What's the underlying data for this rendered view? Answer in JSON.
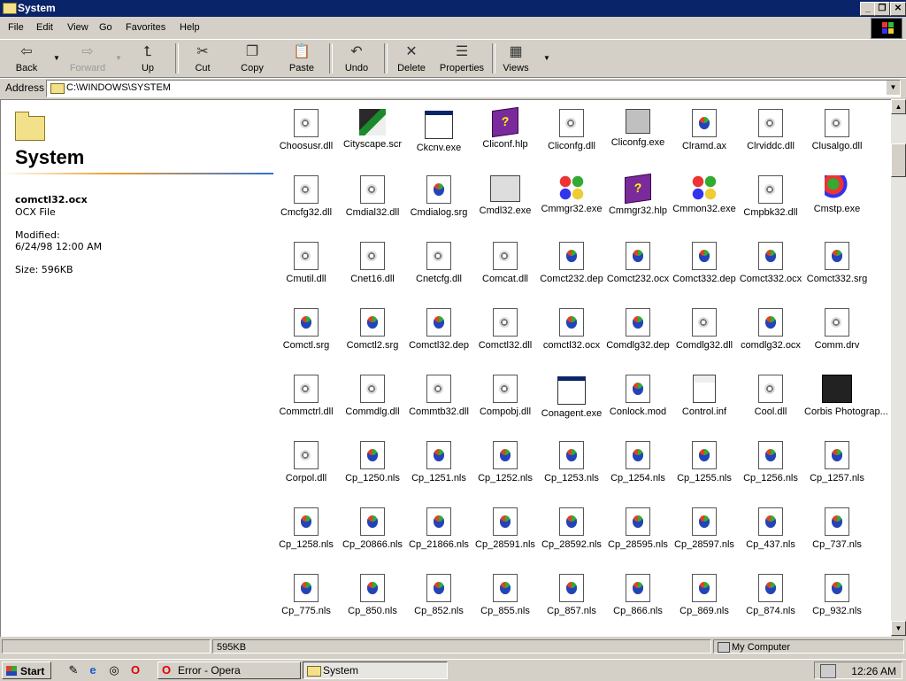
{
  "window": {
    "title": "System",
    "controls": [
      "_",
      "❐",
      "✕"
    ]
  },
  "menu": [
    "File",
    "Edit",
    "View",
    "Go",
    "Favorites",
    "Help"
  ],
  "toolbar": {
    "back": "Back",
    "forward": "Forward",
    "up": "Up",
    "cut": "Cut",
    "copy": "Copy",
    "paste": "Paste",
    "undo": "Undo",
    "delete": "Delete",
    "properties": "Properties",
    "views": "Views"
  },
  "address": {
    "label": "Address",
    "value": "C:\\WINDOWS\\SYSTEM"
  },
  "sidebar": {
    "title": "System",
    "file_name": "comctl32.ocx",
    "file_type": "OCX File",
    "modified_label": "Modified:",
    "modified_value": "6/24/98 12:00 AM",
    "size": "Size: 596KB"
  },
  "files": [
    {
      "name": "Choosusr.dll",
      "icon": "gear-doc"
    },
    {
      "name": "Cityscape.scr",
      "icon": "screensaver"
    },
    {
      "name": "Ckcnv.exe",
      "icon": "app-window"
    },
    {
      "name": "Cliconf.hlp",
      "icon": "help-book"
    },
    {
      "name": "Cliconfg.dll",
      "icon": "gear-doc"
    },
    {
      "name": "Cliconfg.exe",
      "icon": "computer"
    },
    {
      "name": "Clramd.ax",
      "icon": "windows-doc"
    },
    {
      "name": "Clrviddc.dll",
      "icon": "gear-doc"
    },
    {
      "name": "Clusalgo.dll",
      "icon": "gear-doc"
    },
    {
      "name": "Cmcfg32.dll",
      "icon": "gear-doc"
    },
    {
      "name": "Cmdial32.dll",
      "icon": "gear-doc"
    },
    {
      "name": "Cmdialog.srg",
      "icon": "windows-doc"
    },
    {
      "name": "Cmdl32.exe",
      "icon": "printer"
    },
    {
      "name": "Cmmgr32.exe",
      "icon": "command-knot"
    },
    {
      "name": "Cmmgr32.hlp",
      "icon": "help-book"
    },
    {
      "name": "Cmmon32.exe",
      "icon": "command-knot"
    },
    {
      "name": "Cmpbk32.dll",
      "icon": "gear-doc"
    },
    {
      "name": "Cmstp.exe",
      "icon": "cmstp"
    },
    {
      "name": "Cmutil.dll",
      "icon": "gear-doc"
    },
    {
      "name": "Cnet16.dll",
      "icon": "gear-doc"
    },
    {
      "name": "Cnetcfg.dll",
      "icon": "gear-doc"
    },
    {
      "name": "Comcat.dll",
      "icon": "gear-doc"
    },
    {
      "name": "Comct232.dep",
      "icon": "windows-doc"
    },
    {
      "name": "Comct232.ocx",
      "icon": "windows-doc"
    },
    {
      "name": "Comct332.dep",
      "icon": "windows-doc"
    },
    {
      "name": "Comct332.ocx",
      "icon": "windows-doc"
    },
    {
      "name": "Comct332.srg",
      "icon": "windows-doc"
    },
    {
      "name": "Comctl.srg",
      "icon": "windows-doc"
    },
    {
      "name": "Comctl2.srg",
      "icon": "windows-doc"
    },
    {
      "name": "Comctl32.dep",
      "icon": "windows-doc"
    },
    {
      "name": "Comctl32.dll",
      "icon": "gear-doc"
    },
    {
      "name": "comctl32.ocx",
      "icon": "windows-doc"
    },
    {
      "name": "Comdlg32.dep",
      "icon": "windows-doc"
    },
    {
      "name": "Comdlg32.dll",
      "icon": "gear-doc"
    },
    {
      "name": "comdlg32.ocx",
      "icon": "windows-doc"
    },
    {
      "name": "Comm.drv",
      "icon": "gear-doc"
    },
    {
      "name": "Commctrl.dll",
      "icon": "gear-doc"
    },
    {
      "name": "Commdlg.dll",
      "icon": "gear-doc"
    },
    {
      "name": "Commtb32.dll",
      "icon": "gear-doc"
    },
    {
      "name": "Compobj.dll",
      "icon": "gear-doc"
    },
    {
      "name": "Conagent.exe",
      "icon": "app-window"
    },
    {
      "name": "Conlock.mod",
      "icon": "windows-doc"
    },
    {
      "name": "Control.inf",
      "icon": "settings-sheet"
    },
    {
      "name": "Cool.dll",
      "icon": "gear-doc"
    },
    {
      "name": "Corbis Photograp...",
      "icon": "film-viewer"
    },
    {
      "name": "Corpol.dll",
      "icon": "gear-doc"
    },
    {
      "name": "Cp_1250.nls",
      "icon": "windows-doc"
    },
    {
      "name": "Cp_1251.nls",
      "icon": "windows-doc"
    },
    {
      "name": "Cp_1252.nls",
      "icon": "windows-doc"
    },
    {
      "name": "Cp_1253.nls",
      "icon": "windows-doc"
    },
    {
      "name": "Cp_1254.nls",
      "icon": "windows-doc"
    },
    {
      "name": "Cp_1255.nls",
      "icon": "windows-doc"
    },
    {
      "name": "Cp_1256.nls",
      "icon": "windows-doc"
    },
    {
      "name": "Cp_1257.nls",
      "icon": "windows-doc"
    },
    {
      "name": "Cp_1258.nls",
      "icon": "windows-doc"
    },
    {
      "name": "Cp_20866.nls",
      "icon": "windows-doc"
    },
    {
      "name": "Cp_21866.nls",
      "icon": "windows-doc"
    },
    {
      "name": "Cp_28591.nls",
      "icon": "windows-doc"
    },
    {
      "name": "Cp_28592.nls",
      "icon": "windows-doc"
    },
    {
      "name": "Cp_28595.nls",
      "icon": "windows-doc"
    },
    {
      "name": "Cp_28597.nls",
      "icon": "windows-doc"
    },
    {
      "name": "Cp_437.nls",
      "icon": "windows-doc"
    },
    {
      "name": "Cp_737.nls",
      "icon": "windows-doc"
    },
    {
      "name": "Cp_775.nls",
      "icon": "windows-doc"
    },
    {
      "name": "Cp_850.nls",
      "icon": "windows-doc"
    },
    {
      "name": "Cp_852.nls",
      "icon": "windows-doc"
    },
    {
      "name": "Cp_855.nls",
      "icon": "windows-doc"
    },
    {
      "name": "Cp_857.nls",
      "icon": "windows-doc"
    },
    {
      "name": "Cp_866.nls",
      "icon": "windows-doc"
    },
    {
      "name": "Cp_869.nls",
      "icon": "windows-doc"
    },
    {
      "name": "Cp_874.nls",
      "icon": "windows-doc"
    },
    {
      "name": "Cp_932.nls",
      "icon": "windows-doc"
    }
  ],
  "status": {
    "size": "595KB",
    "zone": "My Computer"
  },
  "taskbar": {
    "start": "Start",
    "tasks": [
      {
        "label": "Error - Opera",
        "icon": "opera-icon"
      },
      {
        "label": "System",
        "icon": "folder-icon"
      }
    ],
    "clock": "12:26 AM"
  },
  "colors": {
    "titlebar": "#0a246a",
    "face": "#d4d0c8",
    "folder": "#f3e08a"
  }
}
